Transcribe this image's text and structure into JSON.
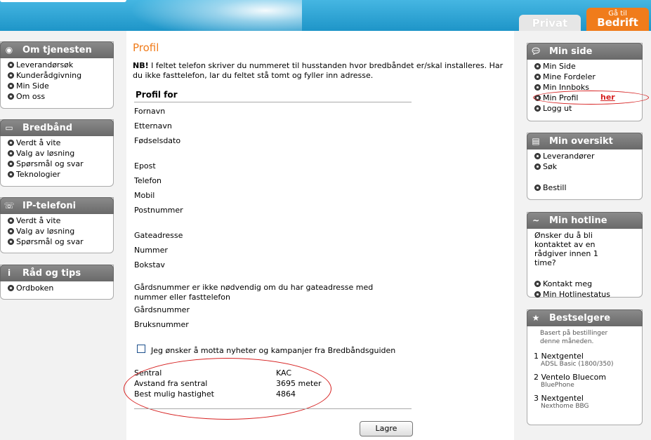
{
  "header": {
    "tab_privat": "Privat",
    "tab_bedrift_small": "Gå til",
    "tab_bedrift_big": "Bedrift"
  },
  "left": {
    "om": {
      "title": "Om tjenesten",
      "items": [
        "Leverandørsøk",
        "Kunderådgivning",
        "Min Side",
        "Om oss"
      ]
    },
    "bredband": {
      "title": "Bredbånd",
      "items": [
        "Verdt å vite",
        "Valg av løsning",
        "Spørsmål og svar",
        "Teknologier"
      ]
    },
    "ip": {
      "title": "IP-telefoni",
      "items": [
        "Verdt å vite",
        "Valg av løsning",
        "Spørsmål og svar"
      ]
    },
    "rad": {
      "title": "Råd og tips",
      "items": [
        "Ordboken"
      ]
    }
  },
  "main": {
    "title": "Profil",
    "note_bold": "NB!",
    "note_text": " I feltet telefon skriver du nummeret til husstanden hvor bredbåndet er/skal installeres. Har du ikke fasttelefon, lar du feltet stå tomt og fyller inn adresse.",
    "profil_for": "Profil for",
    "fields": {
      "fornavn": "Fornavn",
      "etternavn": "Etternavn",
      "fodselsdato": "Fødselsdato",
      "epost": "Epost",
      "telefon": "Telefon",
      "mobil": "Mobil",
      "postnummer": "Postnummer",
      "gateadresse": "Gateadresse",
      "nummer": "Nummer",
      "bokstav": "Bokstav",
      "gardsnummer": "Gårdsnummer",
      "bruksnummer": "Bruksnummer"
    },
    "gard_info": "Gårdsnummer er ikke nødvendig om du har gateadresse med nummer eller fasttelefon",
    "newsletter": "Jeg ønsker å motta nyheter og kampanjer fra Bredbåndsguiden",
    "stats": {
      "sentral_label": "Sentral",
      "sentral_value": "KAC",
      "avstand_label": "Avstand fra sentral",
      "avstand_value": "3695 meter",
      "hastighet_label": "Best mulig hastighet",
      "hastighet_value": "4864"
    },
    "save": "Lagre"
  },
  "right": {
    "minside": {
      "title": "Min side",
      "items": [
        "Min Side",
        "Mine Fordeler",
        "Min Innboks",
        "Min Profil",
        "Logg ut"
      ],
      "annotation": "her"
    },
    "oversikt": {
      "title": "Min oversikt",
      "items": [
        "Leverandører",
        "Søk",
        "Bestill"
      ]
    },
    "hotline": {
      "title": "Min hotline",
      "text": "Ønsker du å bli kontaktet av en rådgiver innen 1 time?",
      "items": [
        "Kontakt meg",
        "Min Hotlinestatus"
      ]
    },
    "bestselgere": {
      "title": "Bestselgere",
      "subtitle": "Basert på bestillinger denne måneden.",
      "items": [
        {
          "rank": "1",
          "name": "Nextgentel",
          "product": "ADSL Basic (1800/350)"
        },
        {
          "rank": "2",
          "name": "Ventelo Bluecom",
          "product": "BluePhone"
        },
        {
          "rank": "3",
          "name": "Nextgentel",
          "product": "Nexthome BBG"
        }
      ]
    }
  },
  "colors": {
    "orange": "#f07c1b",
    "blue": "#2a9fd0",
    "annotation_red": "#d62020"
  }
}
